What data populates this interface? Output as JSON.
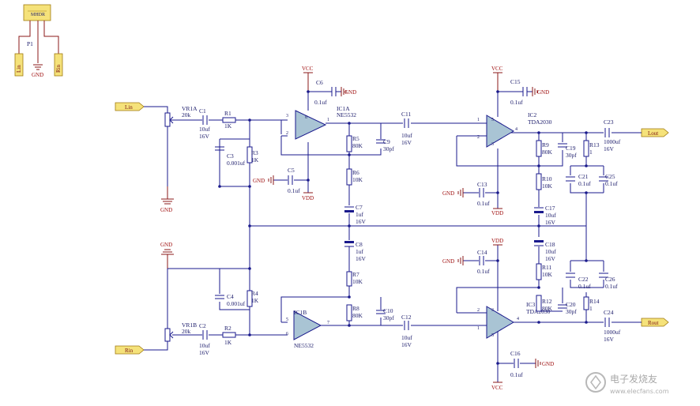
{
  "connector": {
    "ref": "P1",
    "code": "MHDR",
    "pins": [
      "Lin",
      "GND",
      "Rin"
    ]
  },
  "ports": {
    "lin": "Lin",
    "rin": "Rin",
    "lout": "Lout",
    "rout": "Rout"
  },
  "power": {
    "vcc": "VCC",
    "vdd": "VDD",
    "gnd": "GND"
  },
  "components": {
    "vr1a": {
      "ref": "VR1A",
      "val": "20k"
    },
    "vr1b": {
      "ref": "VR1B",
      "val": "20k"
    },
    "c1": {
      "ref": "C1",
      "val": "10uf",
      "v": "16V"
    },
    "c2": {
      "ref": "C2",
      "val": "10uf",
      "v": "16V"
    },
    "r1": {
      "ref": "R1",
      "val": "1K"
    },
    "r2": {
      "ref": "R2",
      "val": "1K"
    },
    "c3": {
      "ref": "C3",
      "val": "0.001uf"
    },
    "r3": {
      "ref": "R3",
      "val": "1K"
    },
    "c4": {
      "ref": "C4",
      "val": "0.001uf"
    },
    "r4": {
      "ref": "R4",
      "val": "1K"
    },
    "ic1a": {
      "ref": "IC1A",
      "part": "NE5532"
    },
    "ic1b": {
      "ref": "IC1B",
      "part": "NE5532"
    },
    "c5": {
      "ref": "C5",
      "val": "0.1uf"
    },
    "c6": {
      "ref": "C6",
      "val": "0.1uf"
    },
    "r5": {
      "ref": "R5",
      "val": "80K"
    },
    "r6": {
      "ref": "R6",
      "val": "10K"
    },
    "r7": {
      "ref": "R7",
      "val": "10K"
    },
    "r8": {
      "ref": "R8",
      "val": "80K"
    },
    "c7": {
      "ref": "C7",
      "val": "1uf",
      "v": "16V"
    },
    "c8": {
      "ref": "C8",
      "val": "1uf",
      "v": "16V"
    },
    "c9": {
      "ref": "C9",
      "val": "30pf"
    },
    "c10": {
      "ref": "C10",
      "val": "30pf"
    },
    "c11": {
      "ref": "C11",
      "val": "10uf",
      "v": "16V"
    },
    "c12": {
      "ref": "C12",
      "val": "10uf",
      "v": "16V"
    },
    "ic2": {
      "ref": "IC2",
      "part": "TDA2030"
    },
    "ic3": {
      "ref": "IC3",
      "part": "TDA2030"
    },
    "c13": {
      "ref": "C13",
      "val": "0.1uf"
    },
    "c14": {
      "ref": "C14",
      "val": "0.1uf"
    },
    "c15": {
      "ref": "C15",
      "val": "0.1uf"
    },
    "c16": {
      "ref": "C16",
      "val": "0.1uf"
    },
    "r9": {
      "ref": "R9",
      "val": "80K"
    },
    "r10": {
      "ref": "R10",
      "val": "10K"
    },
    "r11": {
      "ref": "R11",
      "val": "10K"
    },
    "r12": {
      "ref": "R12",
      "val": "80K"
    },
    "c17": {
      "ref": "C17",
      "val": "10uf",
      "v": "16V"
    },
    "c18": {
      "ref": "C18",
      "val": "10uf",
      "v": "16V"
    },
    "c19": {
      "ref": "C19",
      "val": "30pf"
    },
    "c20": {
      "ref": "C20",
      "val": "30pf"
    },
    "r13": {
      "ref": "R13",
      "val": "1"
    },
    "r14": {
      "ref": "R14",
      "val": "1"
    },
    "c21": {
      "ref": "C21",
      "val": "0.1uf"
    },
    "c22": {
      "ref": "C22",
      "val": "0.1uf"
    },
    "c25": {
      "ref": "C25",
      "val": "0.1uf"
    },
    "c26": {
      "ref": "C26",
      "val": "0.1uf"
    },
    "c23": {
      "ref": "C23",
      "val": "1000uf",
      "v": "16V"
    },
    "c24": {
      "ref": "C24",
      "val": "1000uf",
      "v": "16V"
    }
  },
  "pins": {
    "p1": "1",
    "p2": "2",
    "p3": "3",
    "p4": "4",
    "p5": "5",
    "p6": "6",
    "p7": "7",
    "p8": "8"
  },
  "watermark": {
    "main": "电子发烧友",
    "url": "www.elecfans.com"
  }
}
